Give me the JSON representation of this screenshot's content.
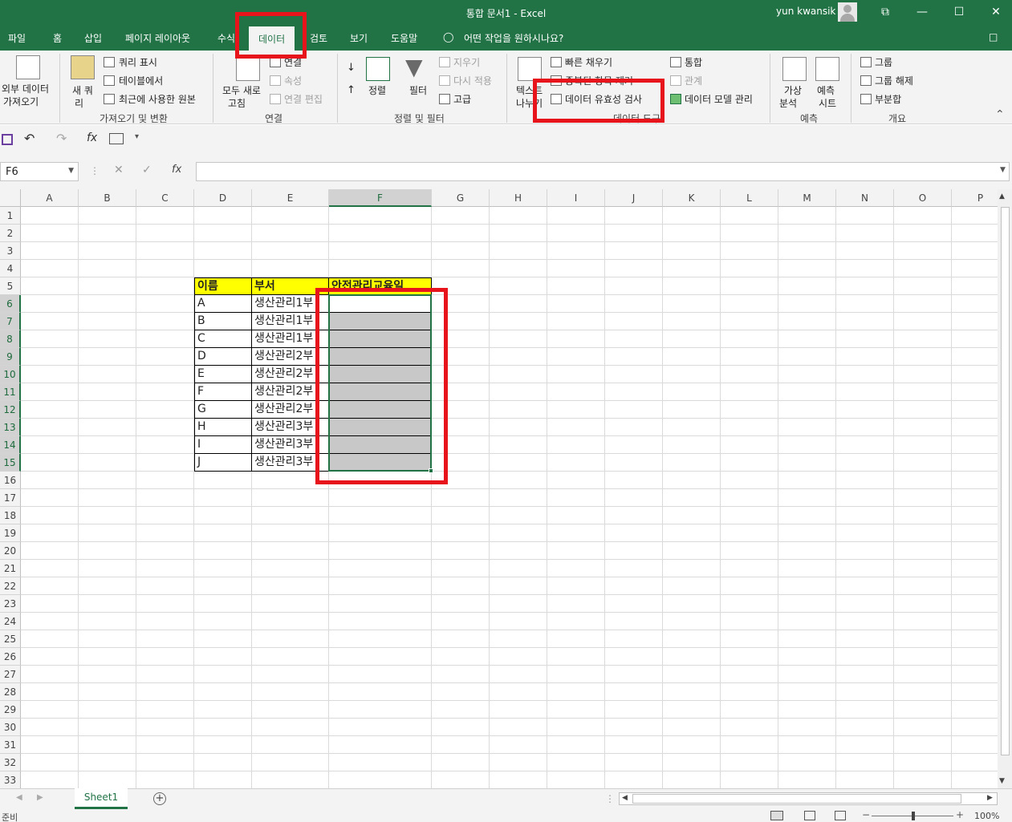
{
  "window": {
    "title": "통합 문서1  -  Excel",
    "user": "yun kwansik",
    "controls": [
      "⧉",
      "—",
      "☐",
      "✕"
    ]
  },
  "tabs": [
    {
      "label": "파일"
    },
    {
      "label": "홈"
    },
    {
      "label": "삽입"
    },
    {
      "label": "페이지 레이아웃"
    },
    {
      "label": "수식"
    },
    {
      "label": "데이터",
      "active": true
    },
    {
      "label": "검토"
    },
    {
      "label": "보기"
    },
    {
      "label": "도움말"
    }
  ],
  "tell_me": "어떤 작업을 원하시나요?",
  "ribbon": {
    "get_transform": {
      "external_data": "외부 데이터",
      "external_data2": "가져오기",
      "new_query": "새 쿼",
      "new_query2": "리",
      "query_show": "쿼리 표시",
      "from_table": "테이블에서",
      "recent_sources": "최근에 사용한 원본",
      "label": "가져오기 및 변환"
    },
    "connections": {
      "refresh_all": "모두 새로",
      "refresh_all2": "고침",
      "connections": "연결",
      "properties": "속성",
      "edit_links": "연결 편집",
      "label": "연결"
    },
    "sort_filter": {
      "sort": "정렬",
      "filter": "필터",
      "clear": "지우기",
      "reapply": "다시 적용",
      "advanced": "고급",
      "label": "정렬 및 필터"
    },
    "data_tools": {
      "text_to_columns": "텍스트",
      "text_to_columns2": "나누기",
      "flash_fill": "빠른 채우기",
      "remove_dup": "중복된 항목 제거",
      "validation": "데이터 유효성 검사",
      "consolidate": "통합",
      "relationships": "관계",
      "data_model": "데이터 모델 관리",
      "label": "데이터 도구"
    },
    "forecast": {
      "what_if": "가상",
      "what_if2": "분석",
      "forecast_sheet": "예측",
      "forecast_sheet2": "시트",
      "label": "예측"
    },
    "outline": {
      "group": "그룹",
      "ungroup": "그룹 해제",
      "subtotal": "부분합",
      "label": "개요"
    }
  },
  "formula_bar": {
    "name_box": "F6",
    "fx": "fx",
    "value": ""
  },
  "columns": [
    "A",
    "B",
    "C",
    "D",
    "E",
    "F",
    "G",
    "H",
    "I",
    "J",
    "K",
    "L",
    "M",
    "N",
    "O",
    "P"
  ],
  "rows": [
    "1",
    "2",
    "3",
    "4",
    "5",
    "6",
    "7",
    "8",
    "9",
    "10",
    "11",
    "12",
    "13",
    "14",
    "15",
    "16",
    "17",
    "18",
    "19",
    "20",
    "21",
    "22",
    "23",
    "24",
    "25",
    "26",
    "27",
    "28",
    "29",
    "30",
    "31",
    "32",
    "33"
  ],
  "selected_column": "F",
  "selected_rows": [
    "6",
    "7",
    "8",
    "9",
    "10",
    "11",
    "12",
    "13",
    "14",
    "15"
  ],
  "table": {
    "headers": [
      "이름",
      "부서",
      "안전관리교육일"
    ],
    "rows": [
      [
        "A",
        "생산관리1부"
      ],
      [
        "B",
        "생산관리1부"
      ],
      [
        "C",
        "생산관리1부"
      ],
      [
        "D",
        "생산관리2부"
      ],
      [
        "E",
        "생산관리2부"
      ],
      [
        "F",
        "생산관리2부"
      ],
      [
        "G",
        "생산관리2부"
      ],
      [
        "H",
        "생산관리3부"
      ],
      [
        "I",
        "생산관리3부"
      ],
      [
        "J",
        "생산관리3부"
      ]
    ],
    "header_color": "#ffff00",
    "selection_fill": "#c8c8c8"
  },
  "sheets": [
    {
      "label": "Sheet1",
      "active": true
    }
  ],
  "status": {
    "ready": "준비",
    "zoom": "100%"
  },
  "colors": {
    "excel_green": "#217346",
    "annotation_red": "#e8141c"
  }
}
